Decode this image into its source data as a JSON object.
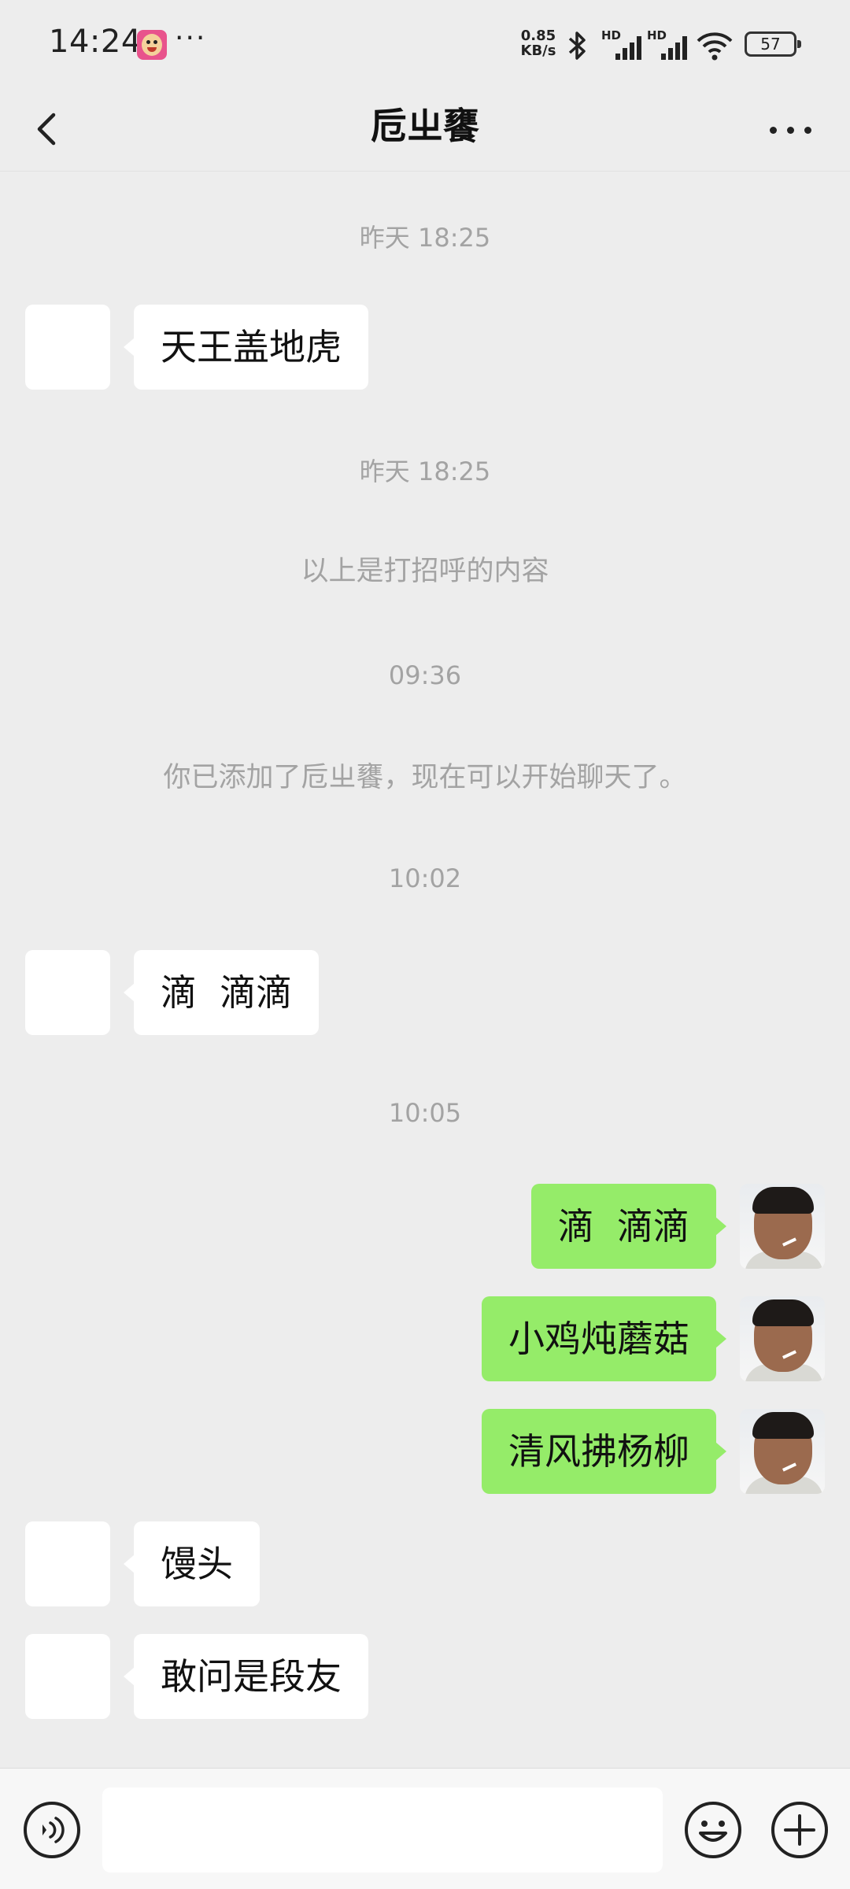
{
  "status_bar": {
    "time": "14:24",
    "more": "···",
    "net_speed_value": "0.85",
    "net_speed_unit": "KB/s",
    "sim1_label": "HD",
    "sim2_label": "HD",
    "battery": "57"
  },
  "header": {
    "title": "卮ㄓ饔",
    "back_icon": "chevron-left-icon",
    "more_icon": "more-dots-icon"
  },
  "chat": {
    "items": [
      {
        "type": "time",
        "text": "昨天 18:25"
      },
      {
        "type": "msg",
        "side": "in",
        "text": "天王盖地虎"
      },
      {
        "type": "time",
        "text": "昨天 18:25"
      },
      {
        "type": "system",
        "text": "以上是打招呼的内容"
      },
      {
        "type": "time",
        "text": "09:36"
      },
      {
        "type": "system",
        "text": "你已添加了卮ㄓ饔，现在可以开始聊天了。"
      },
      {
        "type": "time",
        "text": "10:02"
      },
      {
        "type": "msg",
        "side": "in",
        "text": "滴  滴滴"
      },
      {
        "type": "time",
        "text": "10:05"
      },
      {
        "type": "msg",
        "side": "out",
        "text": "滴  滴滴"
      },
      {
        "type": "msg",
        "side": "out",
        "text": "小鸡炖蘑菇"
      },
      {
        "type": "msg",
        "side": "out",
        "text": "清风拂杨柳"
      },
      {
        "type": "msg",
        "side": "in",
        "text": "馒头"
      },
      {
        "type": "msg",
        "side": "in",
        "text": "敢问是段友"
      }
    ]
  },
  "input_bar": {
    "voice_icon": "voice-icon",
    "input_value": "",
    "emoji_icon": "emoji-icon",
    "plus_icon": "plus-icon"
  },
  "colors": {
    "background": "#ededed",
    "outgoing_bubble": "#95ec69",
    "incoming_bubble": "#ffffff",
    "meta_text": "#a3a3a3"
  }
}
